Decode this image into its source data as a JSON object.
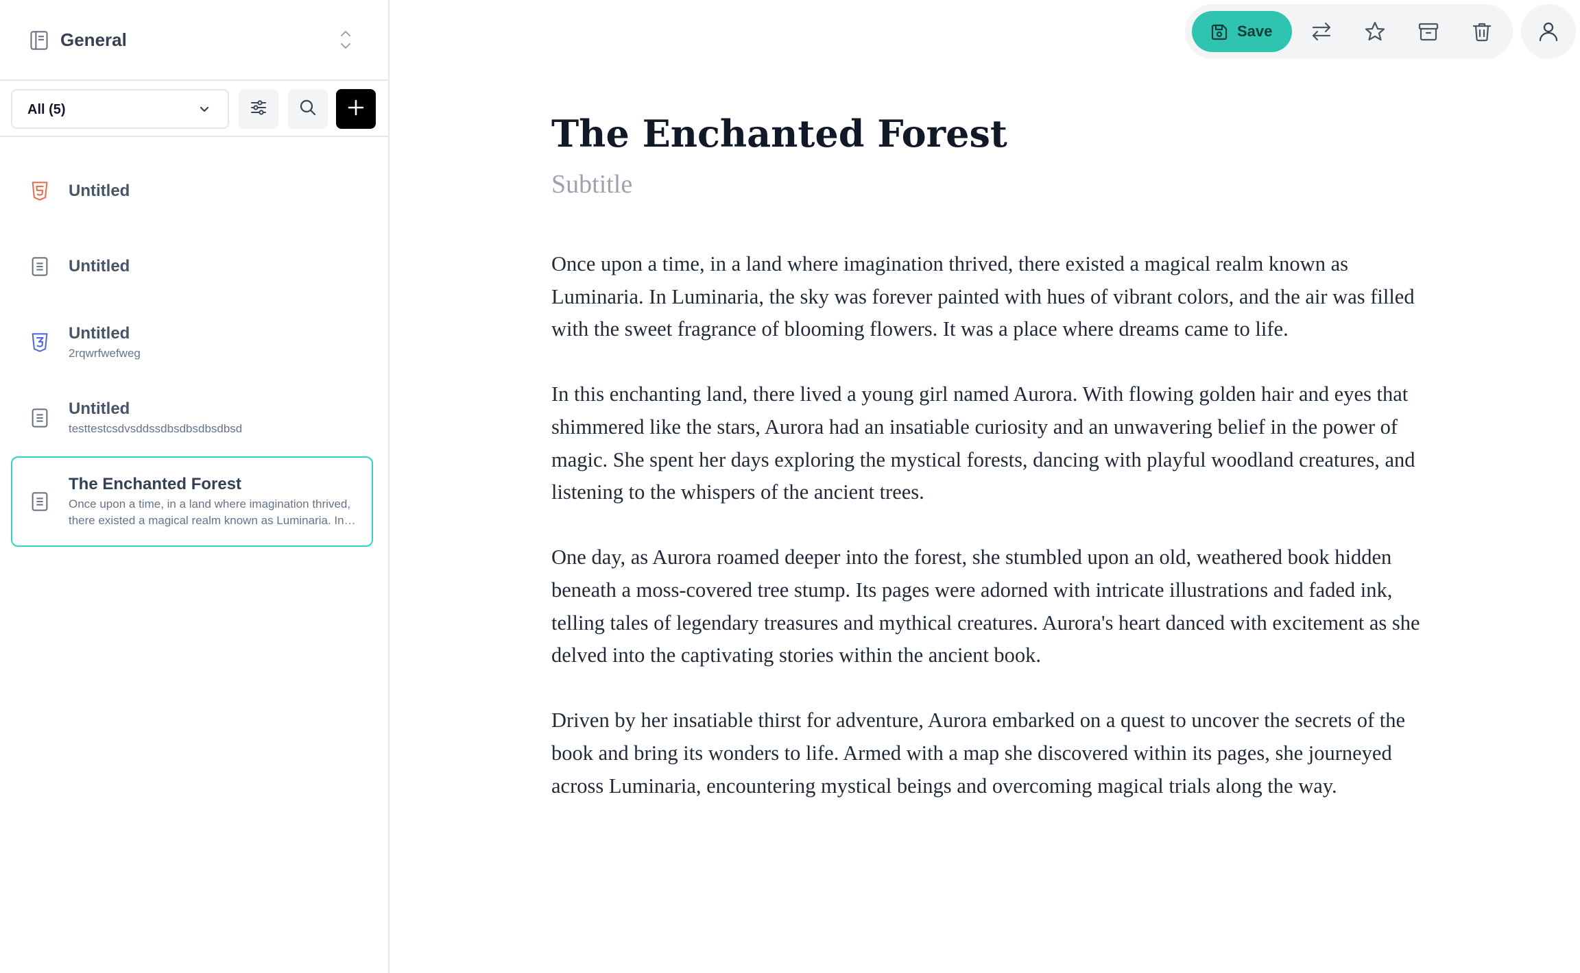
{
  "sidebar": {
    "workspace_name": "General",
    "filter_label": "All (5)",
    "notes": [
      {
        "title": "Untitled",
        "preview": "",
        "icon": "html5-icon",
        "color": "#e76f51"
      },
      {
        "title": "Untitled",
        "preview": "",
        "icon": "document-icon",
        "color": "#6b7280"
      },
      {
        "title": "Untitled",
        "preview": "2rqwrfwefweg",
        "icon": "css3-icon",
        "color": "#4f6bd8"
      },
      {
        "title": "Untitled",
        "preview": "testtestcsdvsddssdbsdbsdbsdbsd",
        "icon": "document-icon",
        "color": "#6b7280"
      },
      {
        "title": "The Enchanted Forest",
        "preview": "Once upon a time, in a land where imagination thrived, there existed a magical realm known as Luminaria. In Luminaria, the sky was forever painted with hues of vibrant colors",
        "icon": "document-icon",
        "color": "#6b7280",
        "active": true
      }
    ]
  },
  "toolbar": {
    "save_label": "Save",
    "accent_color": "#2ec4b0"
  },
  "editor": {
    "title": "The Enchanted Forest",
    "subtitle_placeholder": "Subtitle",
    "paragraphs": [
      "Once upon a time, in a land where imagination thrived, there existed a magical realm known as Luminaria. In Luminaria, the sky was forever painted with hues of vibrant colors, and the air was filled with the sweet fragrance of blooming flowers. It was a place where dreams came to life.",
      "In this enchanting land, there lived a young girl named Aurora. With flowing golden hair and eyes that shimmered like the stars, Aurora had an insatiable curiosity and an unwavering belief in the power of magic. She spent her days exploring the mystical forests, dancing with playful woodland creatures, and listening to the whispers of the ancient trees.",
      "One day, as Aurora roamed deeper into the forest, she stumbled upon an old, weathered book hidden beneath a moss-covered tree stump. Its pages were adorned with intricate illustrations and faded ink, telling tales of legendary treasures and mythical creatures. Aurora's heart danced with excitement as she delved into the captivating stories within the ancient book.",
      "Driven by her insatiable thirst for adventure, Aurora embarked on a quest to uncover the secrets of the book and bring its wonders to life. Armed with a map she discovered within its pages, she journeyed across Luminaria, encountering mystical beings and overcoming magical trials along the way."
    ]
  }
}
